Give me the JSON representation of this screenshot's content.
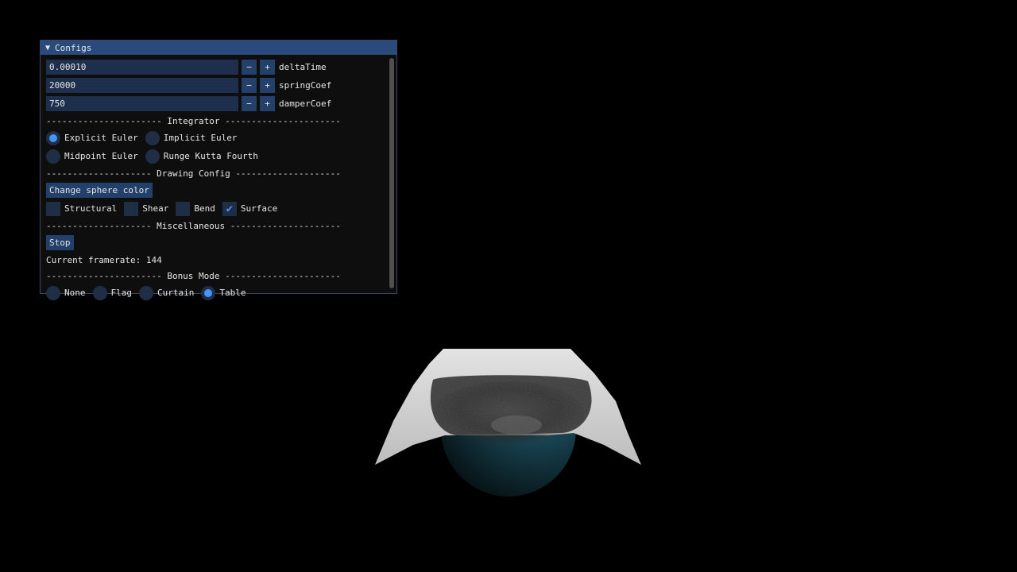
{
  "window": {
    "title": "Configs",
    "collapse_glyph": "▼"
  },
  "params": [
    {
      "value": "0.00010",
      "minus": "−",
      "plus": "+",
      "label": "deltaTime"
    },
    {
      "value": "20000",
      "minus": "−",
      "plus": "+",
      "label": "springCoef"
    },
    {
      "value": "750",
      "minus": "−",
      "plus": "+",
      "label": "damperCoef"
    }
  ],
  "integrator": {
    "separator": "---------------------- Integrator ----------------------",
    "options": [
      {
        "label": "Explicit Euler",
        "selected": true
      },
      {
        "label": "Implicit Euler",
        "selected": false
      },
      {
        "label": "Midpoint Euler",
        "selected": false
      },
      {
        "label": "Runge Kutta Fourth",
        "selected": false
      }
    ]
  },
  "drawing": {
    "separator": "-------------------- Drawing Config --------------------",
    "color_button": "Change sphere color",
    "checks": [
      {
        "label": "Structural",
        "checked": false
      },
      {
        "label": "Shear",
        "checked": false
      },
      {
        "label": "Bend",
        "checked": false
      },
      {
        "label": "Surface",
        "checked": true
      }
    ],
    "check_glyph": "✔"
  },
  "misc": {
    "separator": "-------------------- Miscellaneous ---------------------",
    "stop_button": "Stop",
    "framerate_text": "Current framerate: 144"
  },
  "bonus": {
    "separator": "---------------------- Bonus Mode ----------------------",
    "options": [
      {
        "label": "None",
        "selected": false
      },
      {
        "label": "Flag",
        "selected": false
      },
      {
        "label": "Curtain",
        "selected": false
      },
      {
        "label": "Table",
        "selected": true
      }
    ]
  },
  "colors": {
    "accent": "#4296fa",
    "titlebar": "#294a7a",
    "frame_bg": "#1d2f4d",
    "sphere": "#1c4a5a",
    "cloth": "#d8d8d8"
  }
}
